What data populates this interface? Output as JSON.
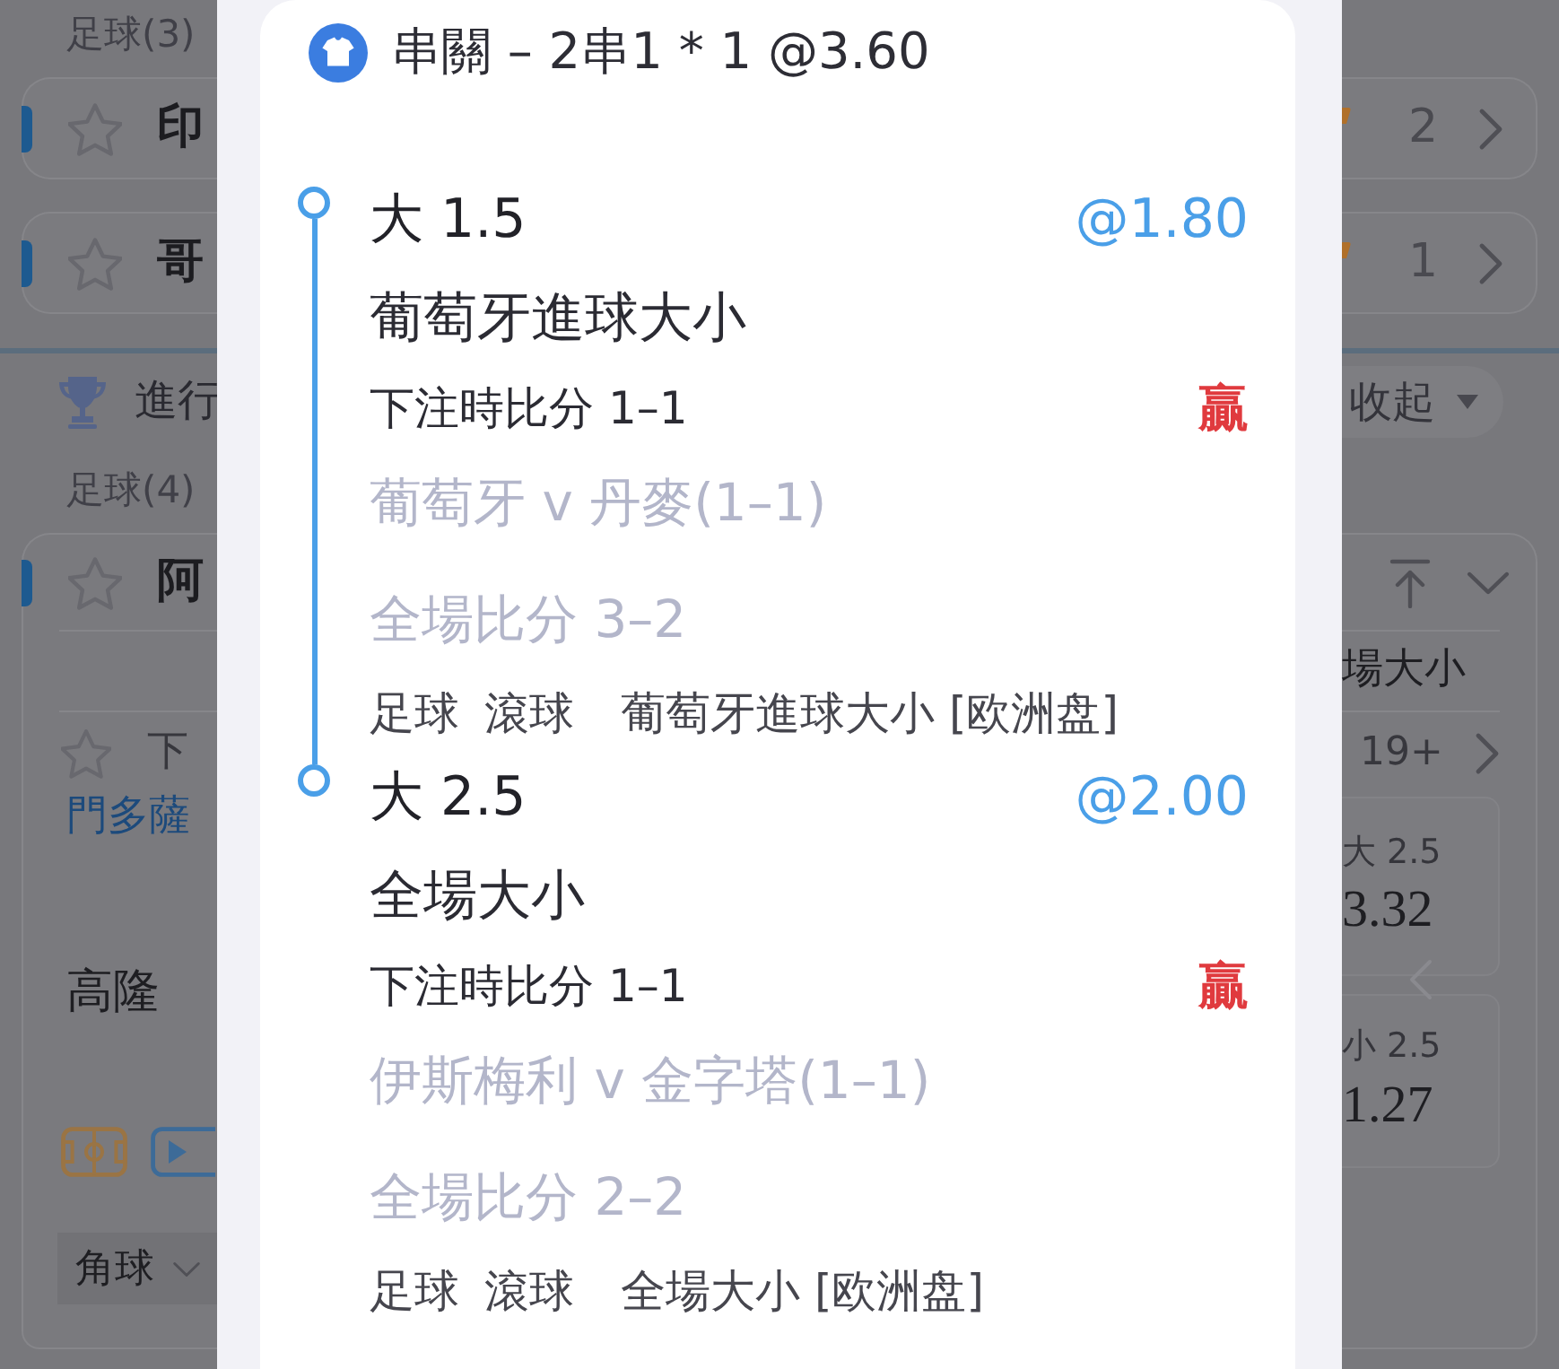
{
  "background": {
    "upper_league": {
      "label": "足球(3)",
      "matches": [
        {
          "team": "印",
          "favorite": false,
          "count": "2"
        },
        {
          "team": "哥",
          "favorite": false,
          "count": "1"
        }
      ]
    },
    "section": {
      "title": "進行",
      "toggle": "收起"
    },
    "lower_league": {
      "label": "足球(4)",
      "match": {
        "team": "阿",
        "favorite": false,
        "market_tab": "場大小",
        "period": {
          "label": "下",
          "favorite": false
        },
        "more_count": "19+",
        "home_team": "門多薩",
        "away_team": "高隆",
        "odds": [
          {
            "line": "大 2.5",
            "price": "3.32"
          },
          {
            "line": "小 2.5",
            "price": "1.27"
          }
        ],
        "market_select": "角球"
      }
    }
  },
  "bet_slip": {
    "title": "串關 – 2串1 * 1 @3.60",
    "legs": [
      {
        "selection": "大 1.5",
        "odds": "@1.80",
        "market": "葡萄牙進球大小",
        "bet_score": "下注時比分 1–1",
        "result": "贏",
        "match": "葡萄牙 v 丹麥(1–1)",
        "full_time_score": "全場比分 3–2",
        "sport": "足球",
        "mode": "滾球",
        "market_type": "葡萄牙進球大小 [欧洲盘]"
      },
      {
        "selection": "大 2.5",
        "odds": "@2.00",
        "market": "全場大小",
        "bet_score": "下注時比分 1–1",
        "result": "贏",
        "match": "伊斯梅利 v 金字塔(1–1)",
        "full_time_score": "全場比分 2–2",
        "sport": "足球",
        "mode": "滾球",
        "market_type": "全場大小 [欧洲盘]"
      }
    ]
  }
}
